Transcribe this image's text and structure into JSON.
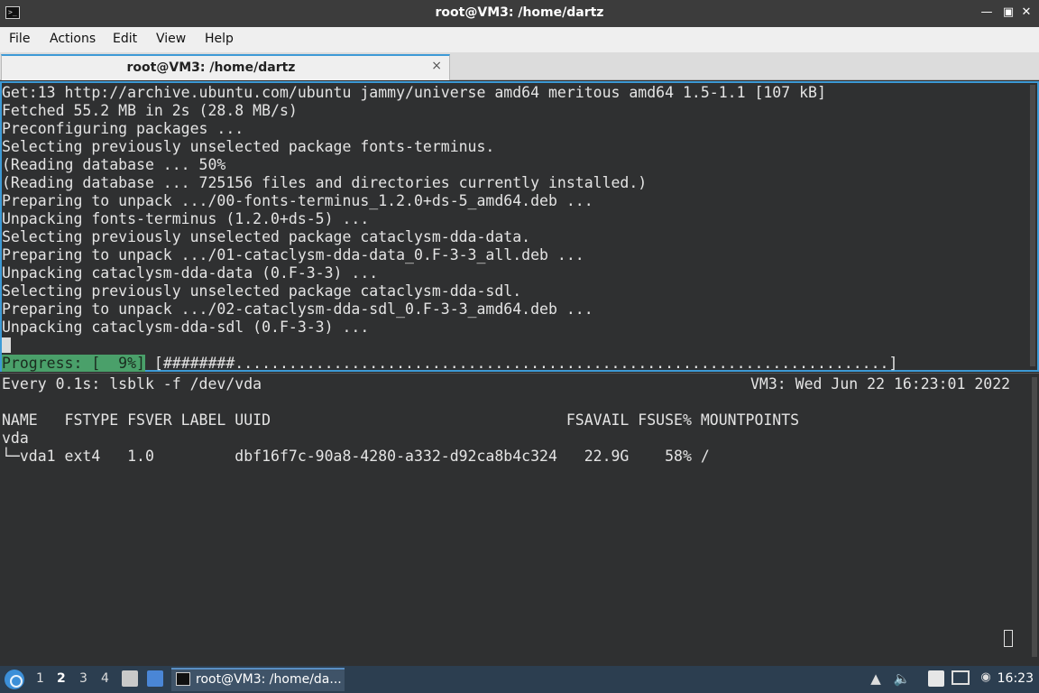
{
  "window": {
    "title": "root@VM3: /home/dartz",
    "minimize_icon": "—",
    "restore_icon": "▣",
    "close_icon": "✕"
  },
  "menu": {
    "items": [
      "File",
      "Actions",
      "Edit",
      "View",
      "Help"
    ]
  },
  "tabs": [
    {
      "label": "root@VM3: /home/dartz",
      "close_icon": "×"
    }
  ],
  "terminal_top": {
    "lines": [
      "Get:13 http://archive.ubuntu.com/ubuntu jammy/universe amd64 meritous amd64 1.5-1.1 [107 kB]",
      "Fetched 55.2 MB in 2s (28.8 MB/s)",
      "Preconfiguring packages ...",
      "Selecting previously unselected package fonts-terminus.",
      "(Reading database ... 50%",
      "(Reading database ... 725156 files and directories currently installed.)",
      "Preparing to unpack .../00-fonts-terminus_1.2.0+ds-5_amd64.deb ...",
      "Unpacking fonts-terminus (1.2.0+ds-5) ...",
      "Selecting previously unselected package cataclysm-dda-data.",
      "Preparing to unpack .../01-cataclysm-dda-data_0.F-3-3_all.deb ...",
      "Unpacking cataclysm-dda-data (0.F-3-3) ...",
      "Selecting previously unselected package cataclysm-dda-sdl.",
      "Preparing to unpack .../02-cataclysm-dda-sdl_0.F-3-3_amd64.deb ...",
      "Unpacking cataclysm-dda-sdl (0.F-3-3) ..."
    ],
    "progress": {
      "label": "Progress: [  9%]",
      "percent": 9,
      "bar": " [########.........................................................................]"
    }
  },
  "terminal_bottom": {
    "watch_header": "Every 0.1s: lsblk -f /dev/vda",
    "watch_status": "VM3: Wed Jun 22 16:23:01 2022",
    "table_header": "NAME   FSTYPE FSVER LABEL UUID                                 FSAVAIL FSUSE% MOUNTPOINTS",
    "rows": [
      "vda",
      "└─vda1 ext4   1.0         dbf16f7c-90a8-4280-a332-d92ca8b4c324   22.9G    58% /"
    ]
  },
  "taskbar": {
    "workspaces": [
      "1",
      "2",
      "3",
      "4"
    ],
    "active_workspace": "2",
    "task_label": "root@VM3: /home/da...",
    "clock": "16:23",
    "icons": [
      "start-menu-icon",
      "file-manager-icon",
      "show-desktop-icon",
      "terminal-icon",
      "tray-up-icon",
      "volume-icon",
      "clipboard-icon",
      "network-icon",
      "notification-icon"
    ]
  },
  "colors": {
    "accent": "#3d9ad6",
    "terminal_bg": "#2f3031",
    "progress_green": "#4aa06a",
    "taskbar_bg": "#2c3e50"
  }
}
